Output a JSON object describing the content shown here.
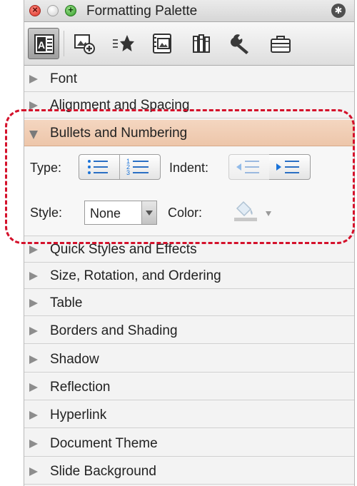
{
  "window": {
    "title": "Formatting Palette"
  },
  "sections_top": [
    {
      "label": "Font"
    },
    {
      "label": "Alignment and Spacing"
    }
  ],
  "open_section": {
    "label": "Bullets and Numbering",
    "type_label": "Type:",
    "indent_label": "Indent:",
    "style_label": "Style:",
    "style_value": "None",
    "color_label": "Color:"
  },
  "sections_bottom": [
    {
      "label": "Quick Styles and Effects"
    },
    {
      "label": "Size, Rotation, and Ordering"
    },
    {
      "label": "Table"
    },
    {
      "label": "Borders and Shading"
    },
    {
      "label": "Shadow"
    },
    {
      "label": "Reflection"
    },
    {
      "label": "Hyperlink"
    },
    {
      "label": "Document Theme"
    },
    {
      "label": "Slide Background"
    }
  ],
  "colors": {
    "highlight_border": "#d4112b",
    "open_header": "#f4d6c0",
    "bullet_blue": "#1a73d9"
  }
}
